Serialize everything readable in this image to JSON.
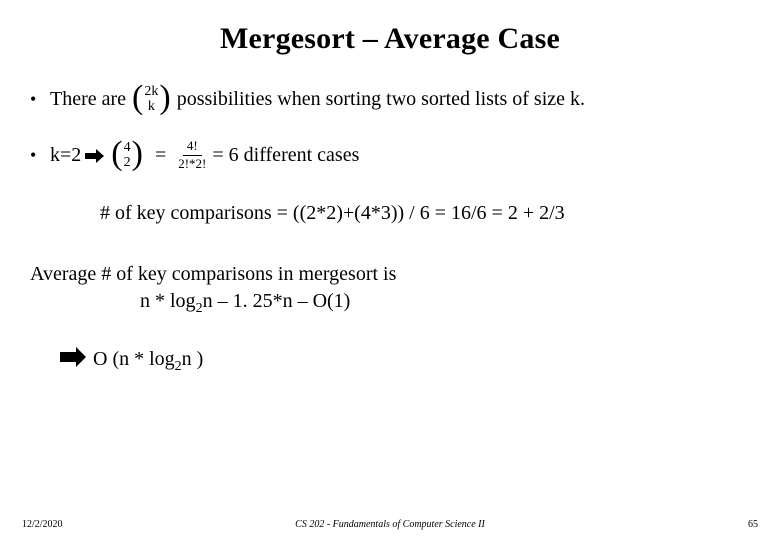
{
  "title": "Mergesort – Average Case",
  "line1": {
    "bullet": "•",
    "lead": "There are",
    "binom_top": "2k",
    "binom_bottom": "k",
    "tail": "possibilities when sorting two sorted lists of size k."
  },
  "line2": {
    "bullet": "•",
    "lead": "k=2",
    "binom_top": "4",
    "binom_bottom": "2",
    "eq1": "=",
    "frac_num": "4!",
    "frac_den": "2!*2!",
    "eq2": "=  6  different cases"
  },
  "line3": "# of key comparisons = ((2*2)+(4*3)) / 6 =  16/6  =  2 + 2/3",
  "para1": "Average # of key comparisons in mergesort is",
  "para2_pre": "n * log",
  "para2_sub": "2",
  "para2_post": "n – 1. 25*n – O(1)",
  "concl_pre": "O (n * log",
  "concl_sub": "2",
  "concl_post": "n )",
  "footer": {
    "left": "12/2/2020",
    "center": "CS 202 - Fundamentals of Computer Science II",
    "right": "65"
  }
}
